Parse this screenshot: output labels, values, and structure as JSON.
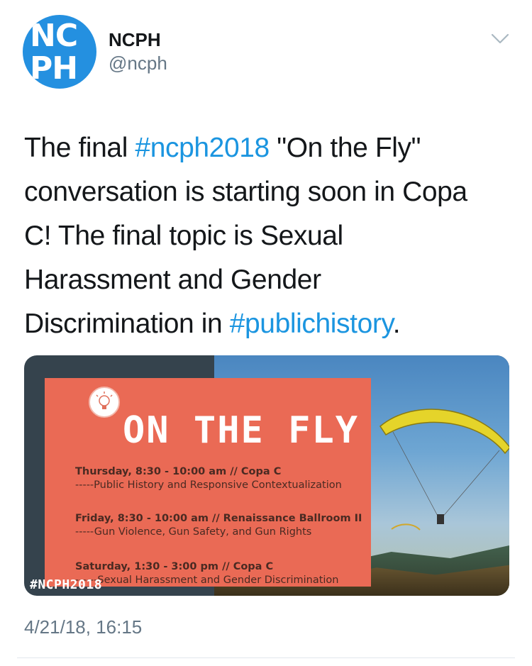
{
  "author": {
    "avatar_text_top": "NC",
    "avatar_text_bottom": "PH",
    "name": "NCPH",
    "handle": "@ncph"
  },
  "tweet": {
    "lines": [
      [
        {
          "t": "The final ",
          "tag": false
        },
        {
          "t": "#ncph2018",
          "tag": true
        },
        {
          "t": " \"On the Fly\"",
          "tag": false
        }
      ],
      [
        {
          "t": "conversation is starting soon in Copa",
          "tag": false
        }
      ],
      [
        {
          "t": "C! The final topic is Sexual",
          "tag": false
        }
      ],
      [
        {
          "t": "Harassment and Gender",
          "tag": false
        }
      ],
      [
        {
          "t": "Discrimination in ",
          "tag": false
        },
        {
          "t": "#publichistory",
          "tag": true
        },
        {
          "t": ".",
          "tag": false
        }
      ]
    ]
  },
  "media": {
    "title": "ON THE FLY",
    "sessions": [
      {
        "heading": "Thursday, 8:30 - 10:00 am // Copa C",
        "topic": "-----Public History and Responsive Contextualization"
      },
      {
        "heading": "Friday, 8:30 - 10:00 am // Renaissance Ballroom II",
        "topic": "-----Gun Violence, Gun Safety, and Gun Rights"
      },
      {
        "heading": "Saturday, 1:30 - 3:00 pm // Copa C",
        "topic": "------Sexual Harassment and Gender Discrimination"
      }
    ],
    "hashtag": "#NCPH2018"
  },
  "timestamp": "4/21/18, 16:15",
  "icons": {
    "menu": "chevron-down-icon",
    "media_bulb": "lightbulb-icon"
  },
  "colors": {
    "link": "#1b95e0",
    "avatar": "#2490e0",
    "panel": "#ea6a55",
    "muted": "#657786"
  }
}
